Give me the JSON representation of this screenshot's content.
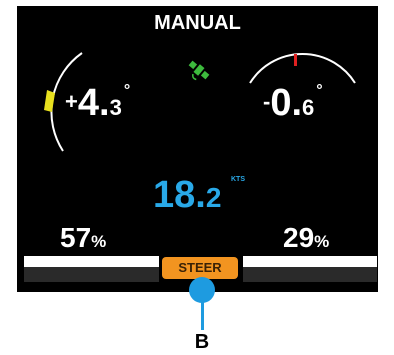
{
  "display": {
    "mode": "MANUAL",
    "heading_left": {
      "sign": "+",
      "int": "4",
      "dot": ".",
      "dec": "3",
      "unit": "°"
    },
    "heading_right": {
      "sign": "-",
      "int": "0",
      "dot": ".",
      "dec": "6",
      "unit": "°"
    },
    "speed": {
      "int": "18",
      "dot": ".",
      "dec": "2",
      "unit": "KTS"
    },
    "left_percent": {
      "value": "57",
      "symbol": "%"
    },
    "right_percent": {
      "value": "29",
      "symbol": "%"
    },
    "steer_button": "STEER",
    "gps_icon": "satellite-icon"
  },
  "annotation": {
    "label": "B"
  },
  "colors": {
    "background": "#000000",
    "speed": "#29a9e8",
    "steer_button": "#f29420",
    "gauge_left_indicator": "#e8e01e",
    "gauge_right_indicator": "#e02020",
    "gps_icon": "#3dbb3d",
    "callout": "#1e9be0"
  }
}
